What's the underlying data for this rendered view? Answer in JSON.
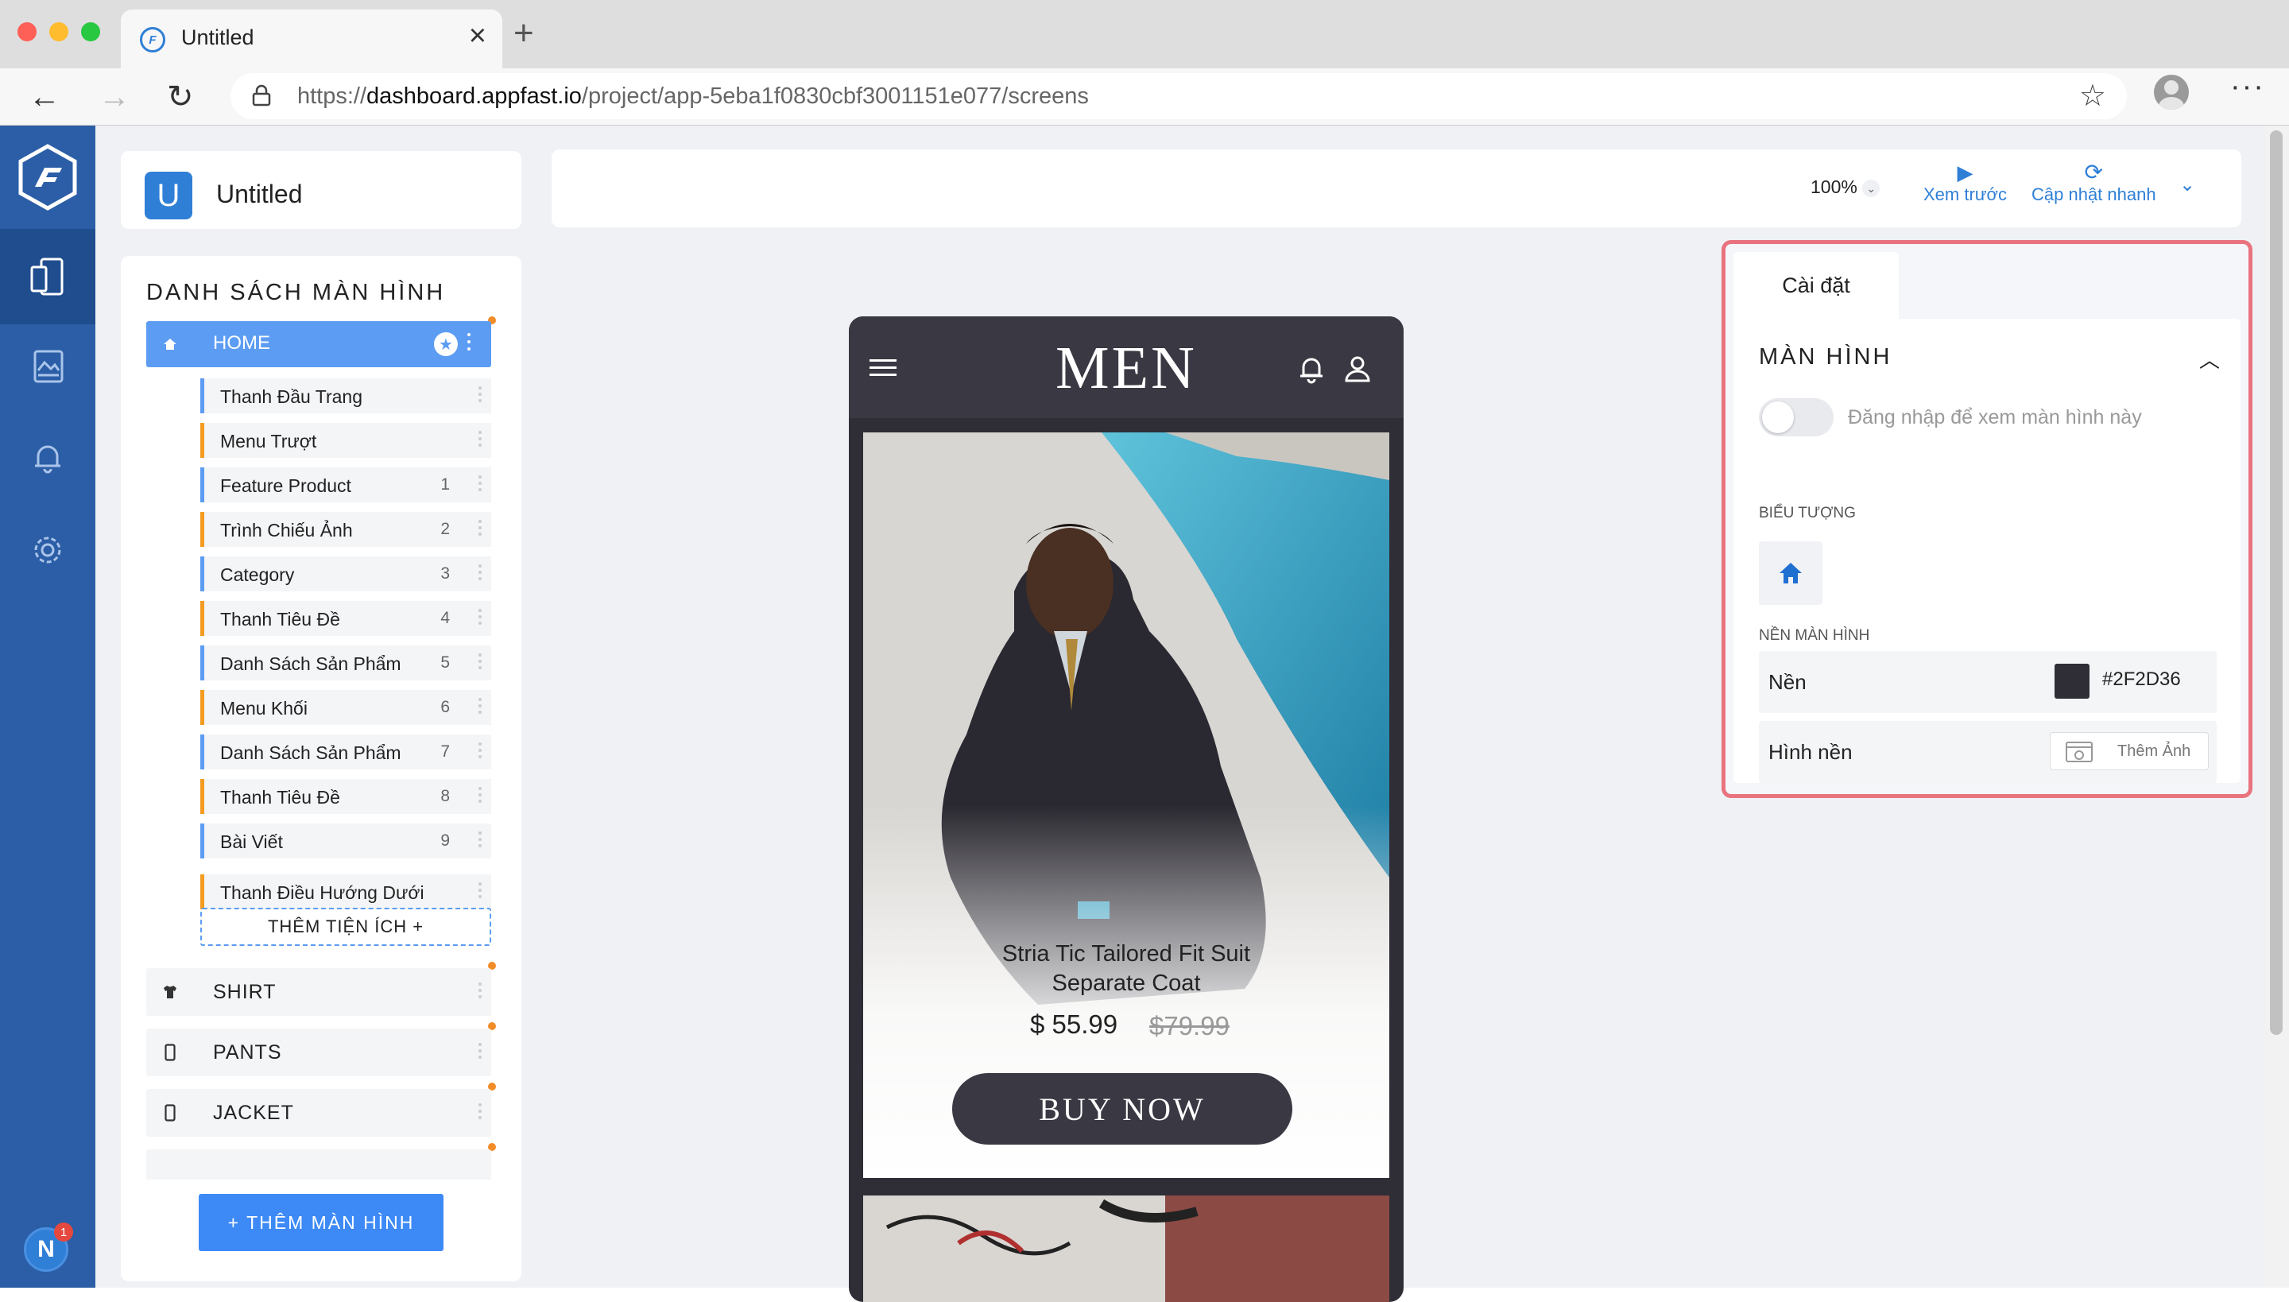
{
  "browser": {
    "tab_title": "Untitled",
    "url_prefix": "https://",
    "url_host": "dashboard.appfast.io",
    "url_path": "/project/app-5eba1f0830cbf3001151e077/screens"
  },
  "project": {
    "logo_letter": "U",
    "title": "Untitled"
  },
  "screen_list": {
    "title": "DANH SÁCH MÀN HÌNH",
    "home": {
      "label": "HOME"
    },
    "widgets": [
      {
        "label": "Thanh Đầu Trang",
        "num": ""
      },
      {
        "label": "Menu Trượt",
        "num": ""
      },
      {
        "label": "Feature Product",
        "num": "1"
      },
      {
        "label": "Trình Chiếu Ảnh",
        "num": "2"
      },
      {
        "label": "Category",
        "num": "3"
      },
      {
        "label": "Thanh Tiêu Đề",
        "num": "4"
      },
      {
        "label": "Danh Sách Sản Phẩm",
        "num": "5"
      },
      {
        "label": "Menu Khối",
        "num": "6"
      },
      {
        "label": "Danh Sách Sản Phẩm",
        "num": "7"
      },
      {
        "label": "Thanh Tiêu Đề",
        "num": "8"
      },
      {
        "label": "Bài Viết",
        "num": "9"
      },
      {
        "label": "Thanh Điều Hướng Dưới",
        "num": ""
      }
    ],
    "add_widget": "THÊM TIỆN ÍCH  +",
    "screens": [
      {
        "label": "SHIRT"
      },
      {
        "label": "PANTS"
      },
      {
        "label": "JACKET"
      }
    ]
  },
  "add_screen_button": "+  THÊM MÀN HÌNH",
  "toolbar": {
    "zoom": "100%",
    "preview": "Xem trước",
    "quick_update": "Cập nhật nhanh"
  },
  "phone": {
    "brand": "MEN",
    "product_name_line1": "Stria Tic Tailored Fit Suit",
    "product_name_line2": "Separate Coat",
    "price": "$ 55.99",
    "old_price": "$79.99",
    "buy_label": "BUY NOW"
  },
  "settings": {
    "tab": "Cài đặt",
    "section_title": "MÀN HÌNH",
    "login_toggle_label": "Đăng nhập để xem màn hình này",
    "icon_heading": "BIỂU TƯỢNG",
    "background_heading": "NỀN MÀN HÌNH",
    "bg_label": "Nền",
    "bg_color": "#2F2D36",
    "bg_image_label": "Hình nền",
    "add_image": "Thêm Ảnh"
  },
  "user": {
    "avatar_letter": "N",
    "notifications": "1"
  },
  "colors": {
    "rail": "#2b5ea6",
    "primary": "#3d8af7",
    "highlight": "#e9737e",
    "accent_orange": "#f39c21"
  }
}
